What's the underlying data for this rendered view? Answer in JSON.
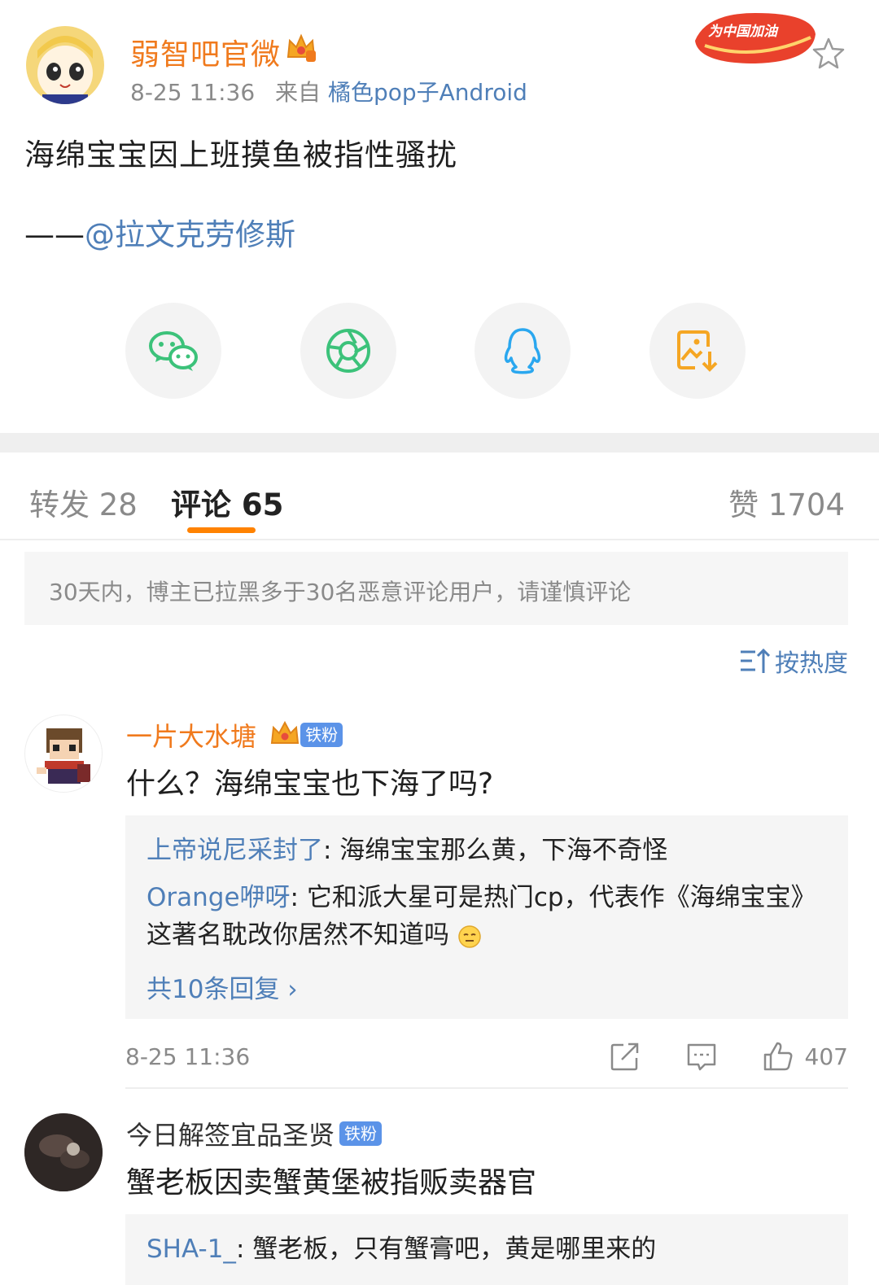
{
  "post": {
    "author": "弱智吧官微",
    "time": "8-25 11:36",
    "source_prefix": "来自",
    "source": "橘色pop子Android",
    "promo_badge": "为中国加油",
    "text": "海绵宝宝因上班摸鱼被指性骚扰",
    "credit_prefix": "——",
    "credit_mention": "@拉文克劳修斯"
  },
  "share": [
    {
      "icon": "wechat-icon"
    },
    {
      "icon": "moments-icon"
    },
    {
      "icon": "qq-icon"
    },
    {
      "icon": "save-image-icon"
    }
  ],
  "tabs": {
    "repost": "转发 28",
    "comments": "评论 65",
    "likes": "赞 1704"
  },
  "notice": "30天内，博主已拉黑多于30名恶意评论用户，请谨慎评论",
  "sort_label": "按热度",
  "comments": [
    {
      "name": "一片大水塘",
      "badge": "铁粉",
      "text": "什么？海绵宝宝也下海了吗?",
      "replies": [
        {
          "who": "上帝说尼采封了",
          "text": ": 海绵宝宝那么黄，下海不奇怪"
        },
        {
          "who": "Orange咿呀",
          "text": ": 它和派大星可是热门cp，代表作《海绵宝宝》",
          "text2": "这著名耽改你居然不知道吗"
        }
      ],
      "more": "共10条回复 ›",
      "time": "8-25 11:36",
      "likes": "407"
    },
    {
      "name": "今日解签宜品圣贤",
      "badge": "铁粉",
      "text": "蟹老板因卖蟹黄堡被指贩卖器官",
      "replies": [
        {
          "who": "SHA-1_",
          "text": ": 蟹老板，只有蟹膏吧，黄是哪里来的"
        }
      ]
    }
  ],
  "colors": {
    "accent_orange": "#ff8200",
    "author_orange": "#f07a1d",
    "link_blue": "#4f7fb8",
    "fan_badge_blue": "#5b93e8"
  }
}
